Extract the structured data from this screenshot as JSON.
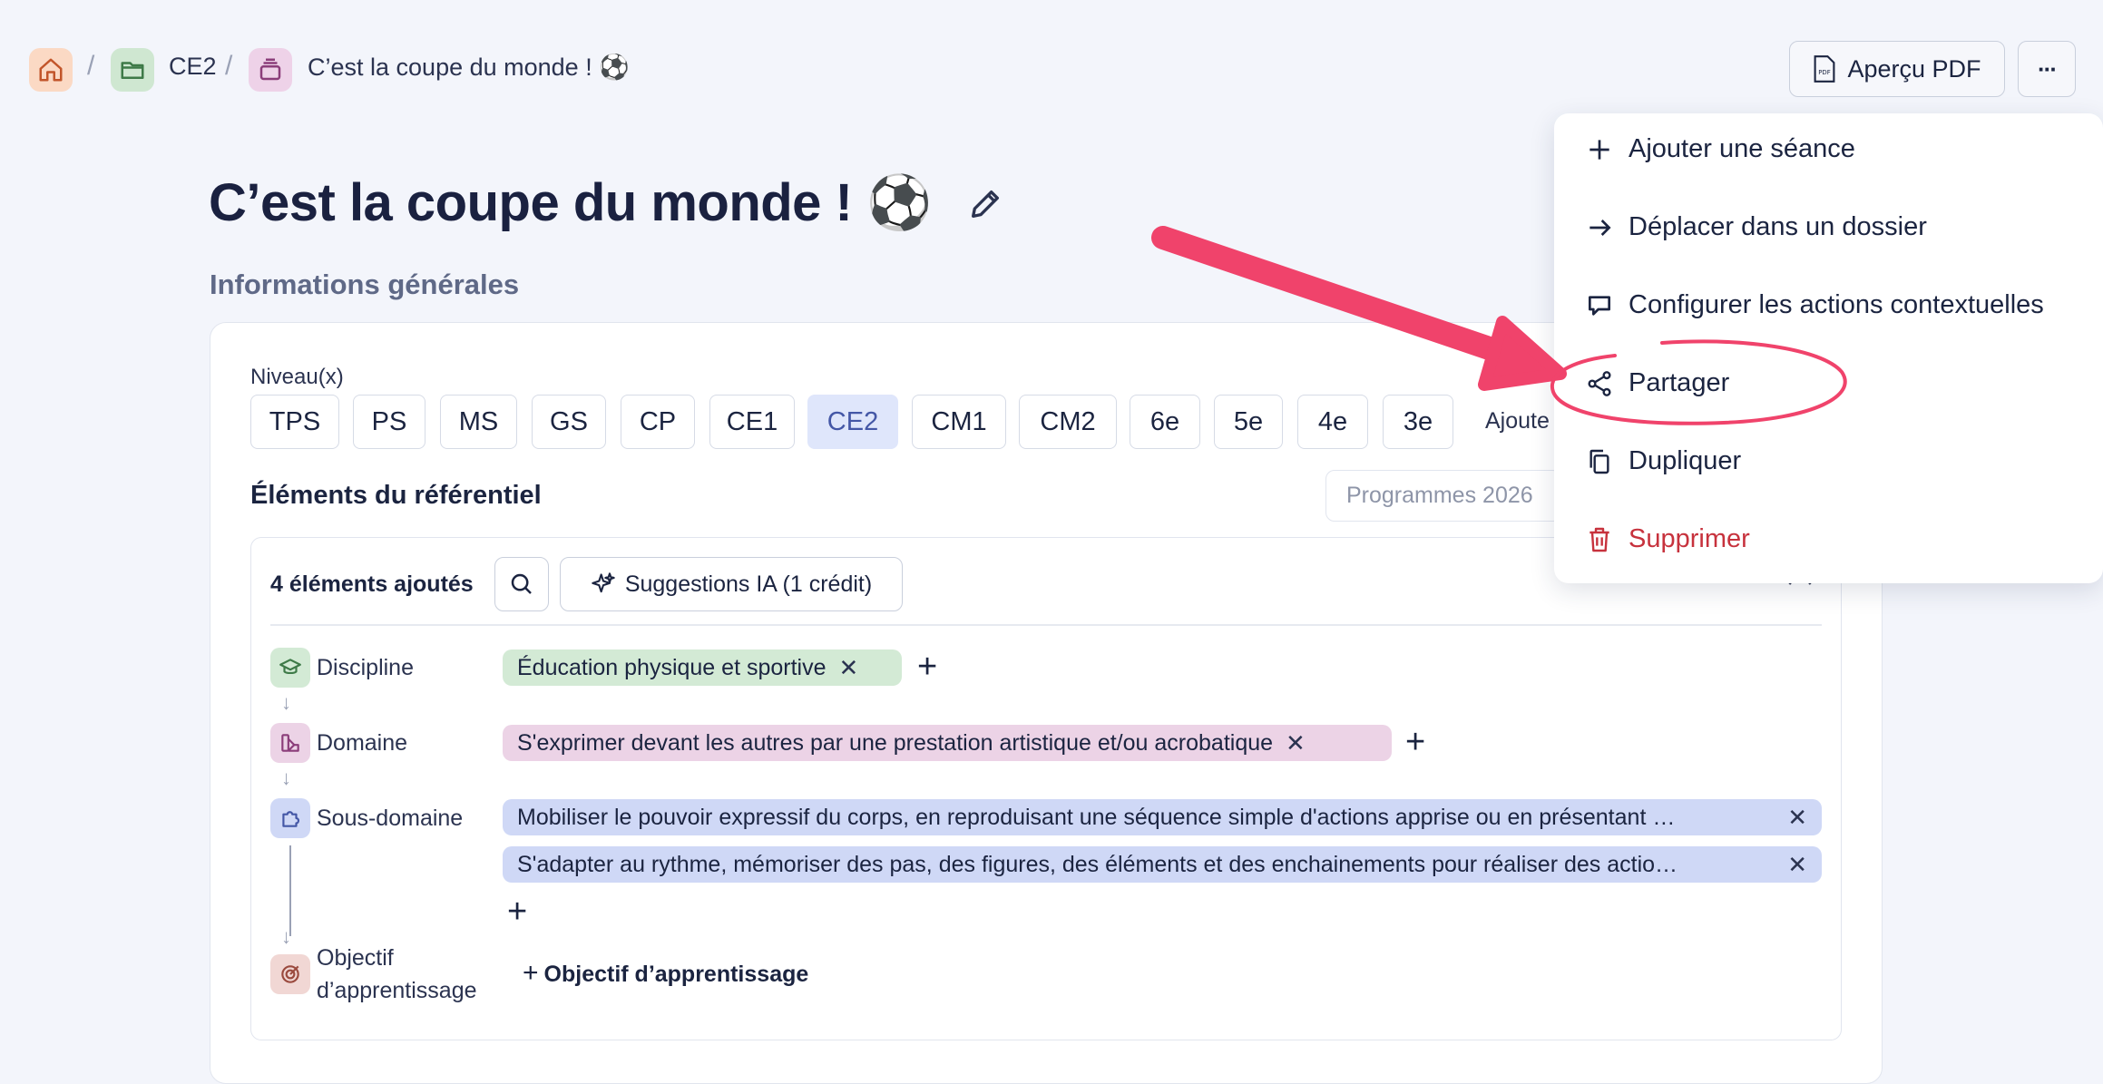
{
  "breadcrumb": {
    "folder": "CE2",
    "current": "C’est la coupe du monde ! ⚽",
    "separator": "/"
  },
  "header": {
    "pdf_badge": "PDF",
    "pdf_label": "Aperçu PDF",
    "more_label": "···"
  },
  "page": {
    "title": "C’est la coupe du monde ! ⚽",
    "section": "Informations générales"
  },
  "levels": {
    "label": "Niveau(x)",
    "items": [
      "TPS",
      "PS",
      "MS",
      "GS",
      "CP",
      "CE1",
      "CE2",
      "CM1",
      "CM2",
      "6e",
      "5e",
      "4e",
      "3e"
    ],
    "selected": "CE2",
    "add_label": "Ajoute"
  },
  "referentiel": {
    "title": "Éléments du référentiel",
    "program": "Programmes 2026",
    "count": "4 éléments ajoutés",
    "ia_label": "Suggestions IA (1 crédit)",
    "rows": {
      "discipline": {
        "label": "Discipline",
        "tags": [
          "Éducation physique et sportive"
        ]
      },
      "domaine": {
        "label": "Domaine",
        "tags": [
          "S'exprimer devant les autres par une prestation artistique et/ou acrobatique"
        ]
      },
      "sous_domaine": {
        "label": "Sous-domaine",
        "tags": [
          "Mobiliser le pouvoir expressif du corps, en reproduisant une séquence simple d'actions apprise ou en présentant …",
          "S'adapter au rythme, mémoriser des pas, des figures, des éléments et des enchainements pour réaliser des actio…"
        ]
      },
      "objectif": {
        "label_line1": "Objectif",
        "label_line2": "d’apprentissage",
        "add_label": "Objectif d’apprentissage"
      }
    }
  },
  "menu": {
    "items": [
      {
        "label": "Ajouter une séance",
        "icon": "plus-icon"
      },
      {
        "label": "Déplacer dans un dossier",
        "icon": "arrow-right-icon"
      },
      {
        "label": "Configurer les actions contextuelles",
        "icon": "speech-bubble-icon"
      },
      {
        "label": "Partager",
        "icon": "share-icon"
      },
      {
        "label": "Dupliquer",
        "icon": "copy-icon"
      },
      {
        "label": "Supprimer",
        "icon": "trash-icon"
      }
    ]
  },
  "colors": {
    "accent_annotation": "#f0436b",
    "danger": "#c7323d",
    "selected_chip": "#dfe6fb",
    "discipline_tag": "#d3ead5",
    "domaine_tag": "#ecd3e6",
    "sous_domaine_tag": "#cfd8f6"
  }
}
